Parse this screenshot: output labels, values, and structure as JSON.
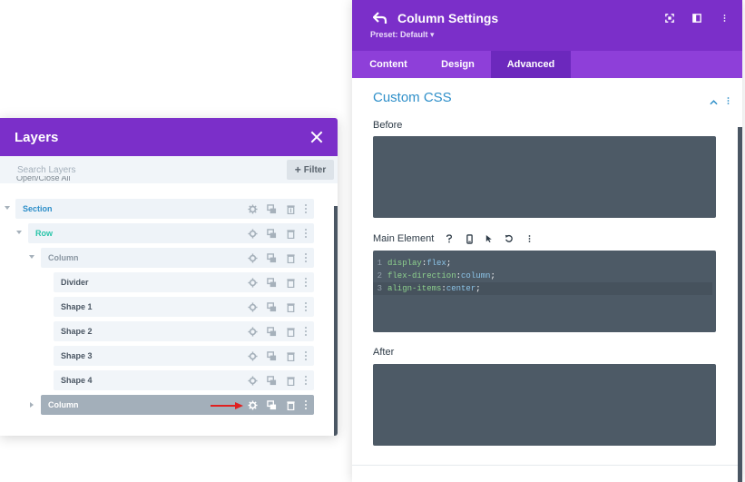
{
  "layers": {
    "title": "Layers",
    "search_placeholder": "Search Layers",
    "filter_label": "Filter",
    "open_close_all": "Open/Close All",
    "items": [
      {
        "label": "Section",
        "color": "#2e8fc9",
        "bg": "#eef3f8",
        "expanded": true
      },
      {
        "label": "Row",
        "color": "#29c4a9",
        "bg": "#eef3f8",
        "expanded": true
      },
      {
        "label": "Column",
        "color": "#8a96a2",
        "bg": "#eef3f8",
        "expanded": true
      },
      {
        "label": "Divider",
        "color": "#4a5663",
        "bg": "#f1f5f9"
      },
      {
        "label": "Shape 1",
        "color": "#4a5663",
        "bg": "#f1f5f9"
      },
      {
        "label": "Shape 2",
        "color": "#4a5663",
        "bg": "#f1f5f9"
      },
      {
        "label": "Shape 3",
        "color": "#4a5663",
        "bg": "#f1f5f9"
      },
      {
        "label": "Shape 4",
        "color": "#4a5663",
        "bg": "#f1f5f9"
      },
      {
        "label": "Column",
        "color": "#ffffff",
        "bg": "#a3afba",
        "expanded": false,
        "selected": true
      }
    ]
  },
  "settings": {
    "title": "Column Settings",
    "preset": "Preset: Default",
    "tabs": [
      {
        "label": "Content",
        "active": false
      },
      {
        "label": "Design",
        "active": false
      },
      {
        "label": "Advanced",
        "active": true
      }
    ],
    "section_title": "Custom CSS",
    "before_label": "Before",
    "main_element_label": "Main Element",
    "after_label": "After",
    "code": [
      {
        "num": "1",
        "prop": "display",
        "value": "flex"
      },
      {
        "num": "2",
        "prop": "flex-direction",
        "value": "column"
      },
      {
        "num": "3",
        "prop": "align-items",
        "value": "center"
      }
    ]
  },
  "colors": {
    "header_purple": "#7b2fc9",
    "tab_purple": "#8e3fd9",
    "tab_active": "#6c28bd",
    "css_box": "#4d5a66",
    "arrow_red": "#e02020"
  }
}
